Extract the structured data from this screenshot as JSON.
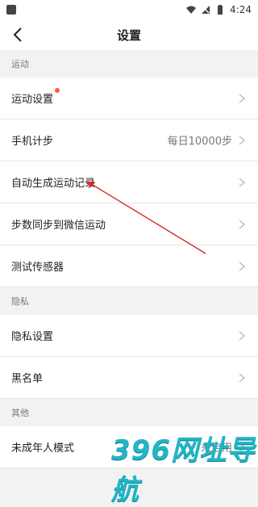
{
  "statusbar": {
    "time": "4:24"
  },
  "navbar": {
    "title": "设置"
  },
  "sections": [
    {
      "header": "运动",
      "rows": [
        {
          "label": "运动设置",
          "value": "",
          "badge": true
        },
        {
          "label": "手机计步",
          "value": "每日10000步"
        },
        {
          "label": "自动生成运动记录",
          "value": ""
        },
        {
          "label": "步数同步到微信运动",
          "value": ""
        },
        {
          "label": "测试传感器",
          "value": ""
        }
      ]
    },
    {
      "header": "隐私",
      "rows": [
        {
          "label": "隐私设置",
          "value": ""
        },
        {
          "label": "黑名单",
          "value": ""
        }
      ]
    },
    {
      "header": "其他",
      "rows": [
        {
          "label": "未成年人模式",
          "value": "未启用"
        }
      ]
    }
  ],
  "annotation": {
    "color": "#d92b2b"
  },
  "watermark": {
    "text": "396网址导航",
    "color": "#20b6c6"
  }
}
